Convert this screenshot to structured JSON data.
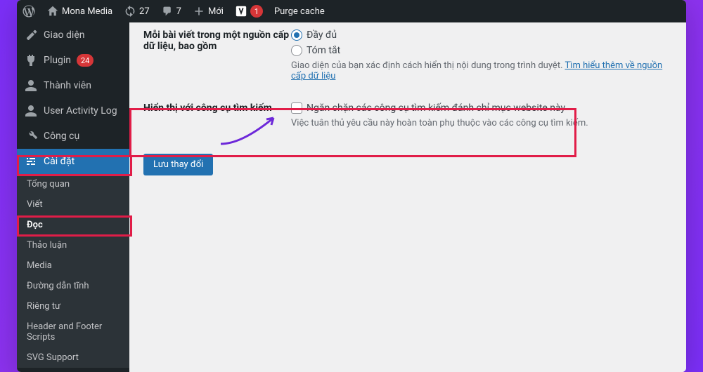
{
  "toolbar": {
    "site_name": "Mona Media",
    "updates_count": "27",
    "comments_count": "7",
    "new_label": "Mới",
    "yoast_badge": "1",
    "purge_label": "Purge cache"
  },
  "sidebar": {
    "items": [
      {
        "label": "Giao diện",
        "icon": "brush"
      },
      {
        "label": "Plugin",
        "icon": "plug",
        "badge": "24"
      },
      {
        "label": "Thành viên",
        "icon": "user"
      },
      {
        "label": "User Activity Log",
        "icon": "user"
      },
      {
        "label": "Công cụ",
        "icon": "wrench"
      },
      {
        "label": "Cài đặt",
        "icon": "sliders",
        "active": true
      }
    ],
    "submenu": [
      {
        "label": "Tổng quan"
      },
      {
        "label": "Viết"
      },
      {
        "label": "Đọc",
        "active": true
      },
      {
        "label": "Thảo luận"
      },
      {
        "label": "Media"
      },
      {
        "label": "Đường dẫn tĩnh"
      },
      {
        "label": "Riêng tư"
      },
      {
        "label": "Header and Footer Scripts"
      },
      {
        "label": "SVG Support"
      }
    ]
  },
  "content": {
    "row1": {
      "label": "Mỗi bài viết trong một nguồn cấp dữ liệu, bao gồm",
      "opt_full": "Đầy đủ",
      "opt_summary": "Tóm tắt",
      "desc_prefix": "Giao diện của bạn xác định cách hiển thị nội dung trong trình duyệt. ",
      "desc_link": "Tìm hiểu thêm về nguồn cấp dữ liệu"
    },
    "row2": {
      "label": "Hiển thị với công cụ tìm kiếm",
      "check_label": "Ngăn chặn các công cụ tìm kiếm đánh chỉ mục website này",
      "desc": "Việc tuân thủ yêu cầu này hoàn toàn phụ thuộc vào các công cụ tìm kiếm."
    },
    "save_button": "Lưu thay đổi"
  }
}
